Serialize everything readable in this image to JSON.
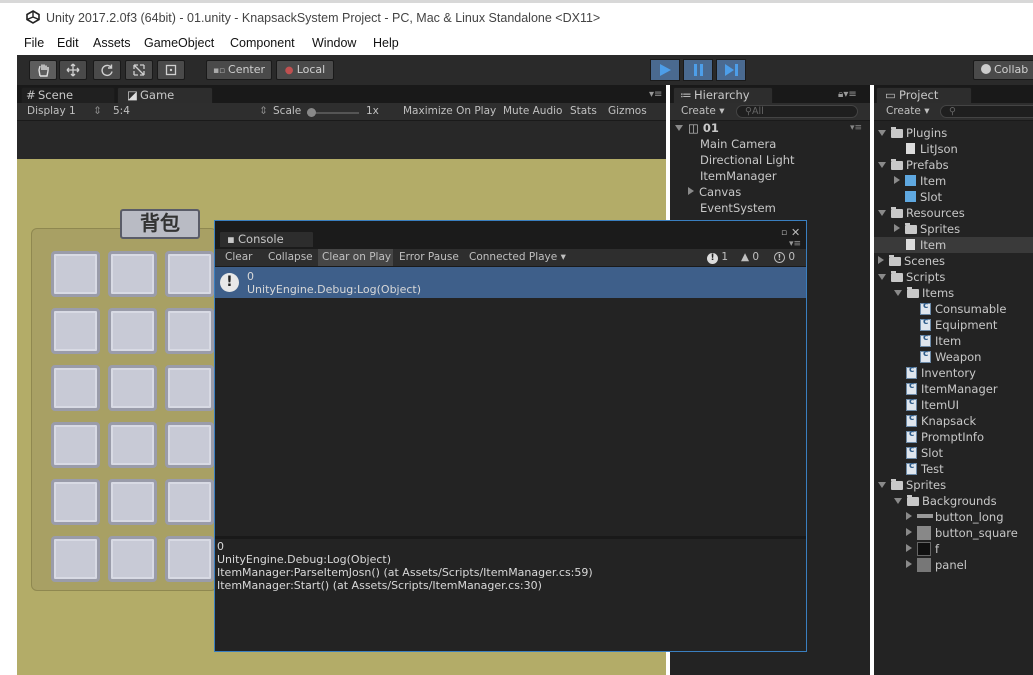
{
  "window": {
    "title": "Unity 2017.2.0f3 (64bit) - 01.unity - KnapsackSystem Project - PC, Mac & Linux Standalone <DX11>"
  },
  "menu": [
    "File",
    "Edit",
    "Assets",
    "GameObject",
    "Component",
    "Window",
    "Help"
  ],
  "toolbar": {
    "center_label": "Center",
    "local_label": "Local",
    "collab_label": "Collab"
  },
  "scene_tab": {
    "label": "Scene"
  },
  "game_tab": {
    "label": "Game",
    "display": "Display 1",
    "aspect": "5:4",
    "scale_label": "Scale",
    "scale_value": "1x",
    "maximize": "Maximize On Play",
    "mute": "Mute Audio",
    "stats": "Stats",
    "gizmos": "Gizmos"
  },
  "game": {
    "bag_title": "背包"
  },
  "hierarchy": {
    "tab_label": "Hierarchy",
    "create_label": "Create",
    "search_placeholder": "All",
    "scene_name": "01",
    "items": [
      "Main Camera",
      "Directional Light",
      "ItemManager",
      "Canvas",
      "EventSystem"
    ]
  },
  "project": {
    "tab_label": "Project",
    "create_label": "Create",
    "tree": [
      "Plugins",
      "LitJson",
      "Prefabs",
      "Item",
      "Slot",
      "Resources",
      "Sprites",
      "Item",
      "Scenes",
      "Scripts",
      "Items",
      "Consumable",
      "Equipment",
      "Item",
      "Weapon",
      "Inventory",
      "ItemManager",
      "ItemUI",
      "Knapsack",
      "PromptInfo",
      "Slot",
      "Test",
      "Sprites",
      "Backgrounds",
      "button_long",
      "button_square",
      "f",
      "panel"
    ]
  },
  "console": {
    "tab_label": "Console",
    "clear": "Clear",
    "collapse": "Collapse",
    "clear_on_play": "Clear on Play",
    "error_pause": "Error Pause",
    "connected_player": "Connected Playe",
    "count_info": "1",
    "count_warn": "0",
    "count_error": "0",
    "entry_line1": "0",
    "entry_line2": "UnityEngine.Debug:Log(Object)",
    "detail": [
      "0",
      "UnityEngine.Debug:Log(Object)",
      "ItemManager:ParseItemJosn() (at Assets/Scripts/ItemManager.cs:59)",
      "ItemManager:Start() (at Assets/Scripts/ItemManager.cs:30)"
    ]
  }
}
